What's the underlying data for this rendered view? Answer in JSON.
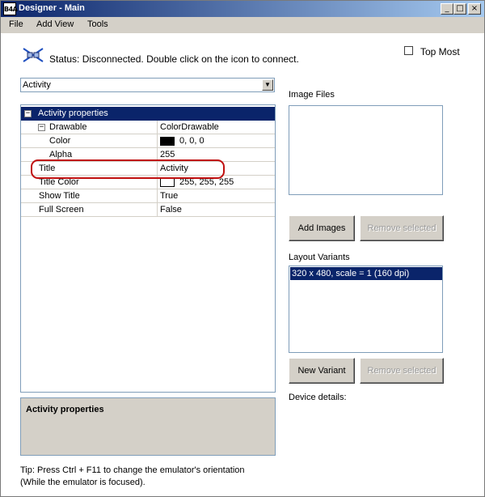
{
  "window": {
    "app_icon_text": "B4A",
    "title": "Designer - Main",
    "minimize_glyph": "_",
    "maximize_glyph": "□",
    "close_glyph": "×"
  },
  "menu": {
    "items": [
      {
        "label": "File"
      },
      {
        "label": "Add View"
      },
      {
        "label": "Tools"
      }
    ]
  },
  "status": {
    "icon": "connection-icon",
    "text": "Status: Disconnected. Double click on the icon to connect."
  },
  "topmost": {
    "label": "Top Most",
    "checked": false
  },
  "module_select": {
    "value": "Activity"
  },
  "properties": {
    "header": "Activity properties",
    "rows": [
      {
        "name": "Drawable",
        "value": "ColorDrawable"
      },
      {
        "name": "Color",
        "value": "0, 0, 0",
        "swatch": "#000000"
      },
      {
        "name": "Alpha",
        "value": "255"
      },
      {
        "name": "Title",
        "value": "Activity"
      },
      {
        "name": "Title Color",
        "value": "255, 255, 255",
        "swatch": "#ffffff"
      },
      {
        "name": "Show Title",
        "value": "True"
      },
      {
        "name": "Full Screen",
        "value": "False"
      }
    ]
  },
  "description": {
    "title": "Activity properties"
  },
  "tip": {
    "line1": "Tip: Press Ctrl + F11 to change the emulator's orientation",
    "line2": "(While the emulator is focused)."
  },
  "image_files": {
    "label": "Image Files",
    "add_button": "Add Images",
    "remove_button": "Remove selected"
  },
  "layout_variants": {
    "label": "Layout Variants",
    "items": [
      "320 x 480, scale = 1 (160 dpi)"
    ],
    "new_button": "New Variant",
    "remove_button": "Remove selected"
  },
  "device": {
    "label": "Device details:"
  },
  "colors": {
    "selection": "#0a246a",
    "highlight_ring": "#c01010",
    "face": "#d4d0c8"
  }
}
